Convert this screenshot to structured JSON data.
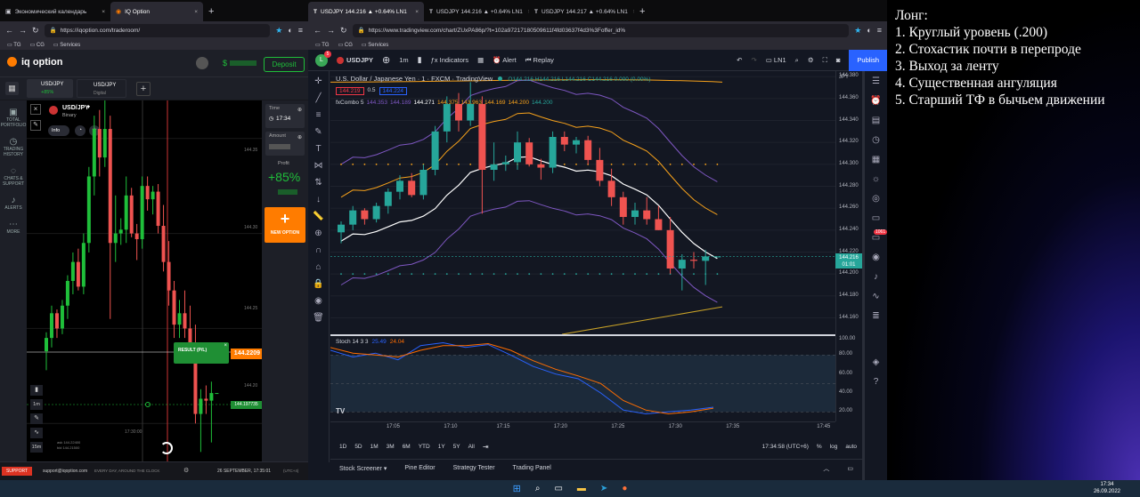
{
  "left_window": {
    "tabs": [
      {
        "label": "Экономический календарь"
      },
      {
        "label": "IQ Option"
      }
    ],
    "url": "https://iqoption.com/traderoom/",
    "bookmarks": [
      "TG",
      "CG",
      "Services"
    ],
    "brand": "iq option",
    "deposit_label": "Deposit",
    "balance": "$",
    "asset_tabs": [
      {
        "label": "USD/JPY",
        "sub": "+85%"
      },
      {
        "label": "USD/JPY",
        "sub": "Digital"
      }
    ],
    "sidebar": [
      {
        "label": "TOTAL PORTFOLIO"
      },
      {
        "label": "TRADING HISTORY"
      },
      {
        "label": "CHATS & SUPPORT"
      },
      {
        "label": "ALERTS"
      },
      {
        "label": "MORE"
      }
    ],
    "asset": {
      "name": "USD/JPY",
      "type": "Binary",
      "info": "Info"
    },
    "time_label": "Time",
    "time_value": "17:34",
    "amount_label": "Amount",
    "profit_label": "Profit",
    "profit_value": "+85%",
    "new_option": "NEW OPTION",
    "price_levels": [
      "144.35",
      "144.30",
      "144.25",
      "144.20"
    ],
    "result_label": "RESULT (P/L)",
    "current_price_tag": "144.2209",
    "strike_price_tag": "144.197735",
    "timeframe": "1m",
    "expiry": "15m",
    "bid_ask": [
      "ask 144.22400",
      "bid 144.21500"
    ],
    "time_marker": "17:30:00",
    "support_label": "SUPPORT",
    "support_email": "support@iqoption.com",
    "slogan": "EVERY DAY, AROUND THE CLOCK",
    "datetime": "26 SEPTEMBER, 17:35:01",
    "timezone": "(UTC+4)"
  },
  "right_window": {
    "tabs": [
      {
        "label": "USDJPY 144.216 ▲ +0.64% LN1"
      },
      {
        "label": "USDJPY 144.216 ▲ +0.64% LN1"
      },
      {
        "label": "USDJPY 144.217 ▲ +0.64% LN1"
      }
    ],
    "url": "https://www.tradingview.com/chart/ZUxPA86p/?t=102a97217180509611f4fd03637f4d3%3Foffer_id%",
    "bookmarks": [
      "TG",
      "CG",
      "Services"
    ],
    "symbol": "USDJPY",
    "interval": "1m",
    "toolbar": {
      "indicators": "Indicators",
      "alert": "Alert",
      "replay": "Replay",
      "layout": "LN1",
      "publish": "Publish"
    },
    "legend": {
      "title": "U.S. Dollar / Japanese Yen · 1 · FXCM · TradingView",
      "ohlc": "O144.216 H144.216 L144.216 C144.216 0.000 (0.00%)",
      "bid": "144.219",
      "spread": "0.5",
      "ask": "144.224",
      "combo_name": "fxCombo 5",
      "combo_values": [
        "144.353",
        "144.189",
        "144.271",
        "144.375",
        "143.963",
        "144.169",
        "144.200",
        "144.200"
      ],
      "stoch_name": "Stoch 14 3 3",
      "stoch_values": [
        "25.49",
        "24.04"
      ]
    },
    "currency": "JPY",
    "price_axis": [
      "144.380",
      "144.360",
      "144.340",
      "144.320",
      "144.300",
      "144.280",
      "144.260",
      "144.240",
      "144.220",
      "144.200",
      "144.180",
      "144.160"
    ],
    "price_tag": {
      "price": "144.216",
      "countdown": "01:01"
    },
    "stoch_axis": [
      "100.00",
      "80.00",
      "60.00",
      "40.00",
      "20.00"
    ],
    "time_axis": [
      "17:05",
      "17:10",
      "17:15",
      "17:20",
      "17:25",
      "17:30",
      "17:35",
      "17:45"
    ],
    "ranges": [
      "1D",
      "5D",
      "1M",
      "3M",
      "6M",
      "YTD",
      "1Y",
      "5Y",
      "All"
    ],
    "clock": "17:34:58 (UTC+6)",
    "scale_opts": [
      "%",
      "log",
      "auto"
    ],
    "bottom_tabs": [
      "Stock Screener",
      "Pine Editor",
      "Strategy Tester",
      "Trading Panel"
    ],
    "badges": {
      "symbol_dot": "5",
      "notifications": "1061"
    }
  },
  "notes": [
    "Лонг:",
    "1. Круглый уровень (.200)",
    "2. Стохастик почти в перепроде",
    "3. Выход за ленту",
    "4. Существенная ангуляция",
    "5. Старший ТФ в бычьем движении"
  ],
  "taskbar": {
    "time": "17:34",
    "date": "26.09.2022"
  },
  "colors": {
    "up": "#26a69a",
    "down": "#ef5350",
    "iq_green": "#1fbf3a",
    "iq_orange": "#ff7c00",
    "tv_blue": "#2962ff"
  },
  "chart_data": [
    {
      "type": "candlestick",
      "title": "U.S. Dollar / Japanese Yen · 1 · FXCM",
      "x": [
        "17:02",
        "17:03",
        "17:04",
        "17:05",
        "17:06",
        "17:07",
        "17:08",
        "17:09",
        "17:10",
        "17:11",
        "17:12",
        "17:13",
        "17:14",
        "17:15",
        "17:16",
        "17:17",
        "17:18",
        "17:19",
        "17:20",
        "17:21",
        "17:22",
        "17:23",
        "17:24",
        "17:25",
        "17:26",
        "17:27",
        "17:28",
        "17:29",
        "17:30",
        "17:31",
        "17:32",
        "17:33",
        "17:34"
      ],
      "ohlc": [
        [
          144.238,
          144.248,
          144.228,
          144.245
        ],
        [
          144.245,
          144.262,
          144.24,
          144.258
        ],
        [
          144.258,
          144.26,
          144.245,
          144.25
        ],
        [
          144.25,
          144.265,
          144.247,
          144.262
        ],
        [
          144.262,
          144.278,
          144.255,
          144.275
        ],
        [
          144.275,
          144.29,
          144.268,
          144.285
        ],
        [
          144.285,
          144.292,
          144.27,
          144.272
        ],
        [
          144.272,
          144.3,
          144.268,
          144.295
        ],
        [
          144.295,
          144.335,
          144.29,
          144.33
        ],
        [
          144.33,
          144.362,
          144.32,
          144.355
        ],
        [
          144.355,
          144.365,
          144.33,
          144.34
        ],
        [
          144.34,
          144.375,
          144.335,
          144.355
        ],
        [
          144.355,
          144.362,
          144.255,
          144.295
        ],
        [
          144.295,
          144.32,
          144.285,
          144.3
        ],
        [
          144.3,
          144.308,
          144.294,
          144.302
        ],
        [
          144.302,
          144.33,
          144.295,
          144.32
        ],
        [
          144.32,
          144.324,
          144.298,
          144.3
        ],
        [
          144.3,
          144.305,
          144.286,
          144.297
        ],
        [
          144.297,
          144.33,
          144.292,
          144.325
        ],
        [
          144.325,
          144.33,
          144.312,
          144.318
        ],
        [
          144.318,
          144.325,
          144.31,
          144.322
        ],
        [
          144.322,
          144.326,
          144.3,
          144.304
        ],
        [
          144.304,
          144.315,
          144.28,
          144.285
        ],
        [
          144.285,
          144.296,
          144.262,
          144.27
        ],
        [
          144.27,
          144.275,
          144.245,
          144.252
        ],
        [
          144.252,
          144.265,
          144.245,
          144.258
        ],
        [
          144.258,
          144.27,
          144.245,
          144.25
        ],
        [
          144.25,
          144.262,
          144.24,
          144.24
        ],
        [
          144.24,
          144.252,
          144.2,
          144.205
        ],
        [
          144.205,
          144.218,
          144.185,
          144.213
        ],
        [
          144.213,
          144.22,
          144.205,
          144.212
        ],
        [
          144.212,
          144.222,
          144.19,
          144.216
        ],
        [
          144.216,
          144.216,
          144.216,
          144.216
        ]
      ],
      "ylim": [
        144.145,
        144.385
      ]
    },
    {
      "type": "line",
      "title": "Stoch 14 3 3",
      "x": [
        "17:00",
        "17:02",
        "17:04",
        "17:06",
        "17:08",
        "17:10",
        "17:12",
        "17:14",
        "17:16",
        "17:18",
        "17:20",
        "17:22",
        "17:24",
        "17:26",
        "17:28",
        "17:30",
        "17:32",
        "17:34"
      ],
      "series": [
        {
          "name": "%K",
          "values": [
            85,
            78,
            82,
            75,
            90,
            93,
            88,
            91,
            80,
            68,
            60,
            55,
            40,
            22,
            18,
            20,
            22,
            25
          ]
        },
        {
          "name": "%D",
          "values": [
            88,
            82,
            80,
            78,
            85,
            90,
            90,
            92,
            85,
            74,
            65,
            58,
            50,
            32,
            22,
            18,
            20,
            24
          ]
        }
      ],
      "ylim": [
        10,
        100
      ]
    }
  ]
}
